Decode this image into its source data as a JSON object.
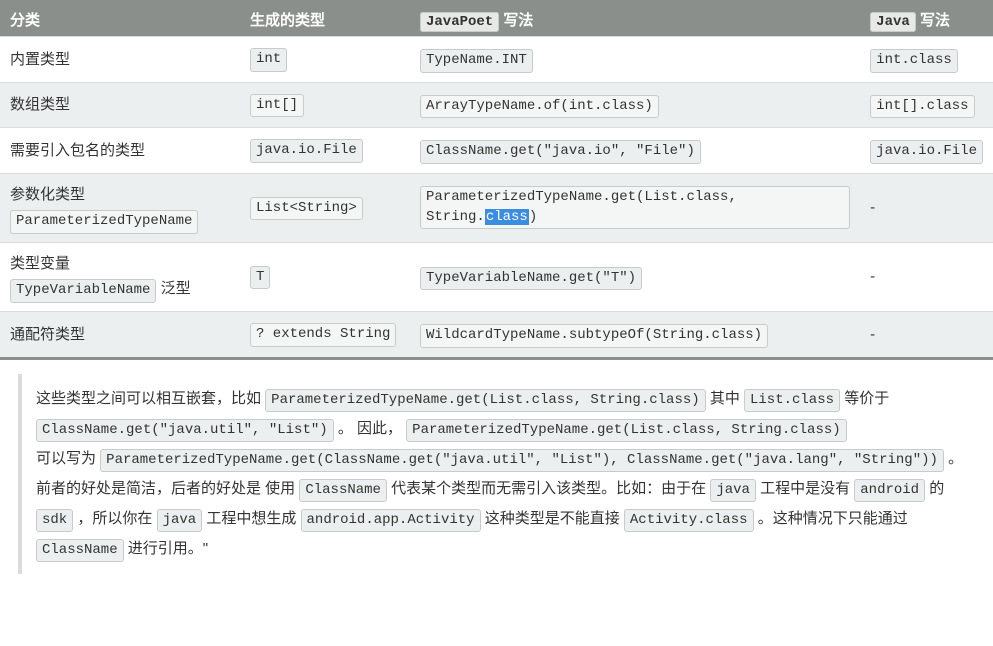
{
  "table": {
    "headers": {
      "category": "分类",
      "generated": "生成的类型",
      "javapoet_code": "JavaPoet",
      "javapoet_suffix": "写法",
      "java_code": "Java",
      "java_suffix": "写法"
    },
    "rows": [
      {
        "category_text": "内置类型",
        "category_code": null,
        "generated": "int",
        "javapoet_pre": "TypeName.INT",
        "javapoet_hl": null,
        "javapoet_post": null,
        "java": "int.class"
      },
      {
        "category_text": "数组类型",
        "category_code": null,
        "generated": "int[]",
        "javapoet_pre": "ArrayTypeName.of(int.class)",
        "javapoet_hl": null,
        "javapoet_post": null,
        "java": "int[].class"
      },
      {
        "category_text": "需要引入包名的类型",
        "category_code": null,
        "generated": "java.io.File",
        "javapoet_pre": "ClassName.get(\"java.io\", \"File\")",
        "javapoet_hl": null,
        "javapoet_post": null,
        "java": "java.io.File"
      },
      {
        "category_text": "参数化类型",
        "category_code": "ParameterizedTypeName",
        "generated": "List<String>",
        "javapoet_pre": "ParameterizedTypeName.get(List.class, String.",
        "javapoet_hl": "class",
        "javapoet_post": ")",
        "java": "-"
      },
      {
        "category_text": "类型变量",
        "category_code": "TypeVariableName",
        "category_suffix": "泛型",
        "generated": "T",
        "javapoet_pre": "TypeVariableName.get(\"T\")",
        "javapoet_hl": null,
        "javapoet_post": null,
        "java": "-"
      },
      {
        "category_text": "通配符类型",
        "category_code": null,
        "generated": "? extends String",
        "javapoet_pre": "WildcardTypeName.subtypeOf(String.class)",
        "javapoet_hl": null,
        "javapoet_post": null,
        "java": "-"
      }
    ]
  },
  "note": {
    "t1": "这些类型之间可以相互嵌套，比如 ",
    "c1": "ParameterizedTypeName.get(List.class, String.class)",
    "t2": " 其中 ",
    "c2": "List.class",
    "t3": " 等价于 ",
    "c3": "ClassName.get(\"java.util\", \"List\")",
    "t4": " 。 因此，",
    "c4": "ParameterizedTypeName.get(List.class, String.class)",
    "t5": "可以写为 ",
    "c5": "ParameterizedTypeName.get(ClassName.get(\"java.util\", \"List\"), ClassName.get(\"java.lang\", \"String\"))",
    "t6": " 。 前者的好处是简洁，后者的好处是 使用 ",
    "c6": "ClassName",
    "t7": " 代表某个类型而无需引入该类型。比如：由于在 ",
    "c7": "java",
    "t8": " 工程中是没有 ",
    "c8": "android",
    "t9": " 的 ",
    "c9": "sdk",
    "t10": " ，所以你在 ",
    "c10": "java",
    "t11": " 工程中想生成 ",
    "c11": "android.app.Activity",
    "t12": " 这种类型是不能直接 ",
    "c12": "Activity.class",
    "t13": " 。这种情况下只能通过 ",
    "c13": "ClassName",
    "t14": " 进行引用。\""
  }
}
